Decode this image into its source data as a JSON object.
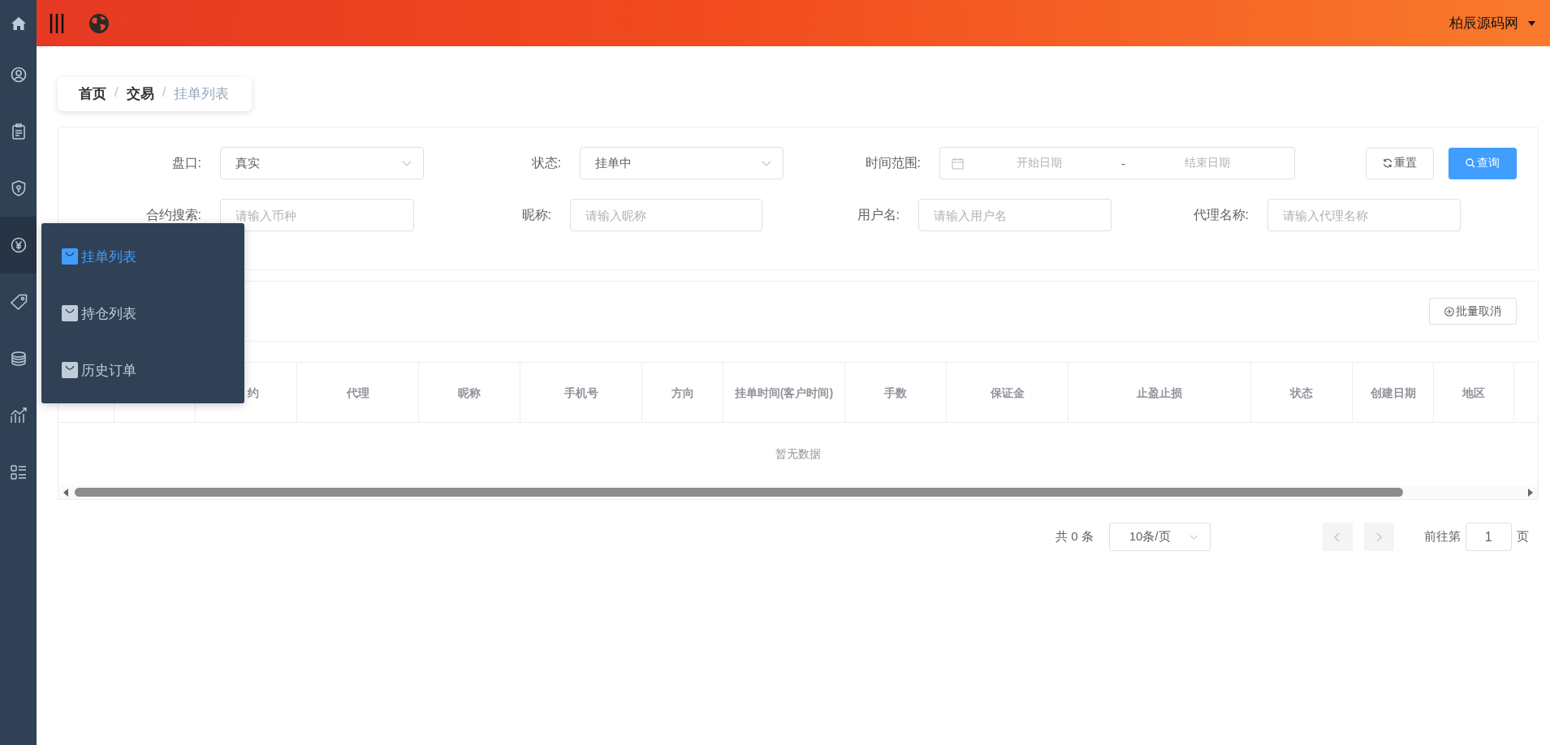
{
  "topbar": {
    "user": "柏辰源码网"
  },
  "sidebar": {
    "items": [
      {
        "kind": "home",
        "selected": false
      },
      {
        "kind": "user",
        "selected": false
      },
      {
        "kind": "clipboard",
        "selected": false
      },
      {
        "kind": "shield",
        "selected": false
      },
      {
        "kind": "yen",
        "selected": true
      },
      {
        "kind": "tag",
        "selected": false
      },
      {
        "kind": "coins",
        "selected": false
      },
      {
        "kind": "chart",
        "selected": false
      },
      {
        "kind": "list",
        "selected": false
      }
    ]
  },
  "breadcrumb": [
    {
      "label": "首页",
      "current": false
    },
    {
      "separator": "/",
      "label": "交易",
      "current": false
    },
    {
      "separator": "/",
      "label": "挂单列表",
      "current": true
    }
  ],
  "filters": {
    "row_1": [
      {
        "kind": "select",
        "label": "盘口:",
        "value": "真实"
      },
      {
        "kind": "select",
        "label": "状态:",
        "value": "挂单中"
      },
      {
        "kind": "daterange",
        "label": "时间范围:",
        "start_placeholder": "开始日期",
        "separator": "-",
        "end_placeholder": "结束日期"
      }
    ],
    "buttons": [
      {
        "label": "重置",
        "primary": false
      },
      {
        "label": "查询",
        "primary": true
      }
    ],
    "row_2": [
      {
        "kind": "input",
        "label": "合约搜索:",
        "placeholder": "请输入币种"
      },
      {
        "kind": "input",
        "label": "昵称:",
        "placeholder": "请输入昵称"
      },
      {
        "kind": "input",
        "label": "用户名:",
        "placeholder": "请输入用户名"
      },
      {
        "kind": "input",
        "label": "代理名称:",
        "placeholder": "请输入代理名称"
      }
    ]
  },
  "toolbar": {
    "batch_cancel": "批量取消"
  },
  "table": {
    "columns": [
      "",
      "",
      "约",
      "代理",
      "昵称",
      "手机号",
      "方向",
      "挂单时间(客户时间)",
      "手数",
      "保证金",
      "止盈止损",
      "状态",
      "创建日期",
      "地区",
      ""
    ],
    "empty_text": "暂无数据"
  },
  "pagination": {
    "total": "共 0 条",
    "page_size": "10条/页",
    "goto_label": "前往第",
    "page": "1",
    "page_suffix": "页"
  },
  "flyout": {
    "items": [
      {
        "label": "挂单列表",
        "selected": true
      },
      {
        "label": "持仓列表",
        "selected": false
      },
      {
        "label": "历史订单",
        "selected": false
      }
    ]
  }
}
